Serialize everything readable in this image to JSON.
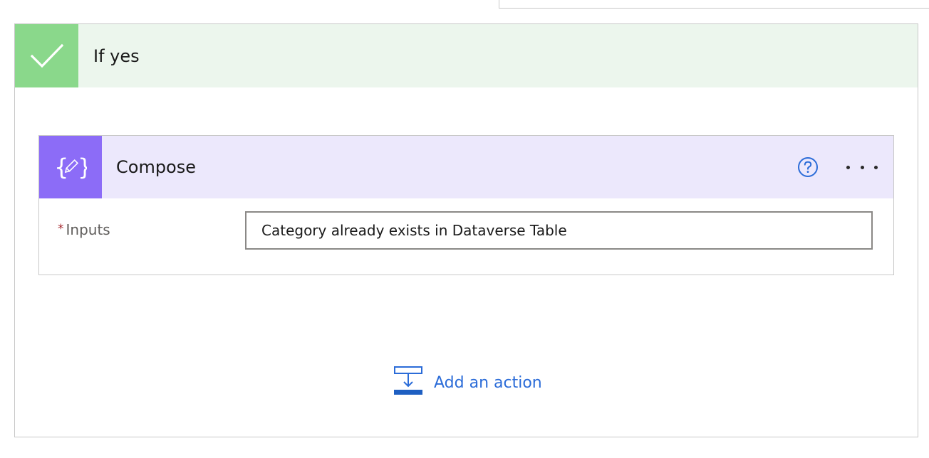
{
  "condition_branch": {
    "title": "If yes",
    "accent": "#8ad88b",
    "header_bg": "#ecf6ed"
  },
  "action": {
    "title": "Compose",
    "icon": "compose-braces-pencil-icon",
    "accent": "#8c6cf7",
    "header_bg": "#ece8fc",
    "help_icon": "help-circle-icon",
    "menu_icon": "more-options-icon",
    "fields": [
      {
        "label": "Inputs",
        "required_marker": "*",
        "value": "Category already exists in Dataverse Table"
      }
    ]
  },
  "add_action": {
    "label": "Add an action",
    "icon": "add-action-icon",
    "color": "#2b6cd8"
  }
}
